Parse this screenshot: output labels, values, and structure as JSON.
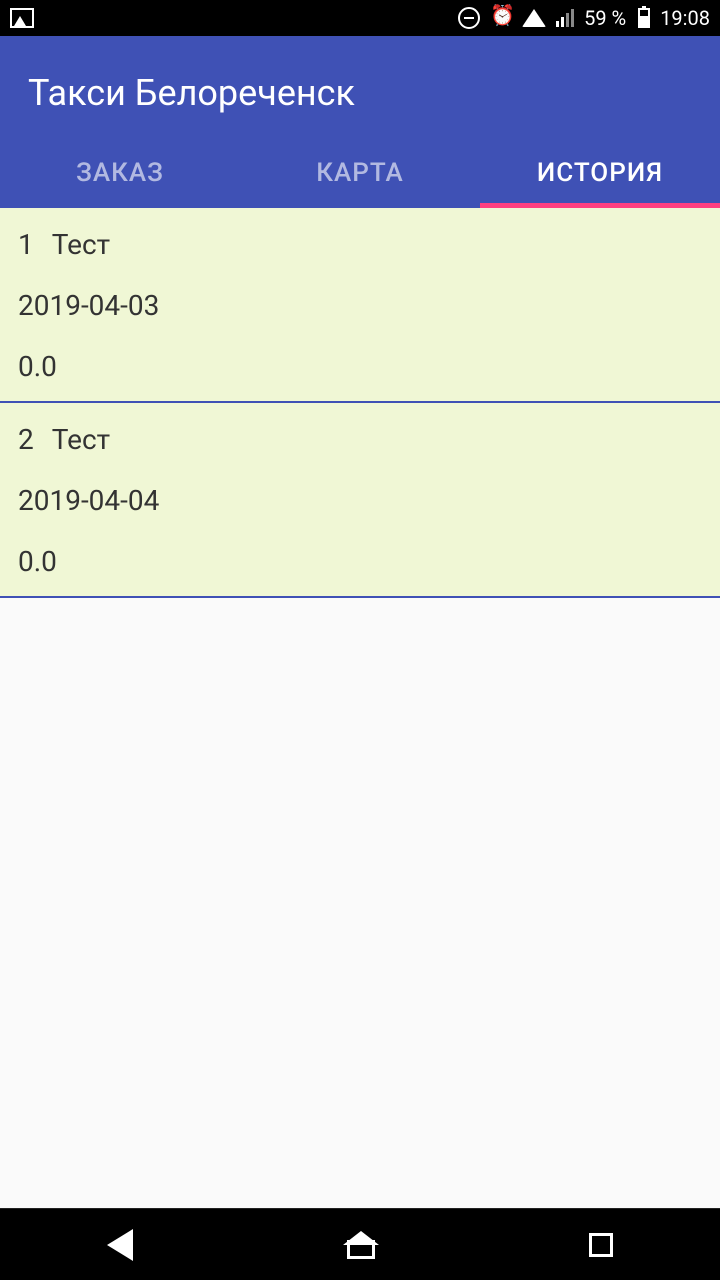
{
  "status": {
    "battery_pct": "59 %",
    "time": "19:08"
  },
  "app": {
    "title": "Такси Белореченск"
  },
  "tabs": {
    "order": "ЗАКАЗ",
    "map": "КАРТА",
    "history": "ИСТОРИЯ"
  },
  "history_items": [
    {
      "index": "1",
      "title": "Тест",
      "date": "2019-04-03",
      "amount": "0.0"
    },
    {
      "index": "2",
      "title": "Тест",
      "date": "2019-04-04",
      "amount": "0.0"
    }
  ]
}
